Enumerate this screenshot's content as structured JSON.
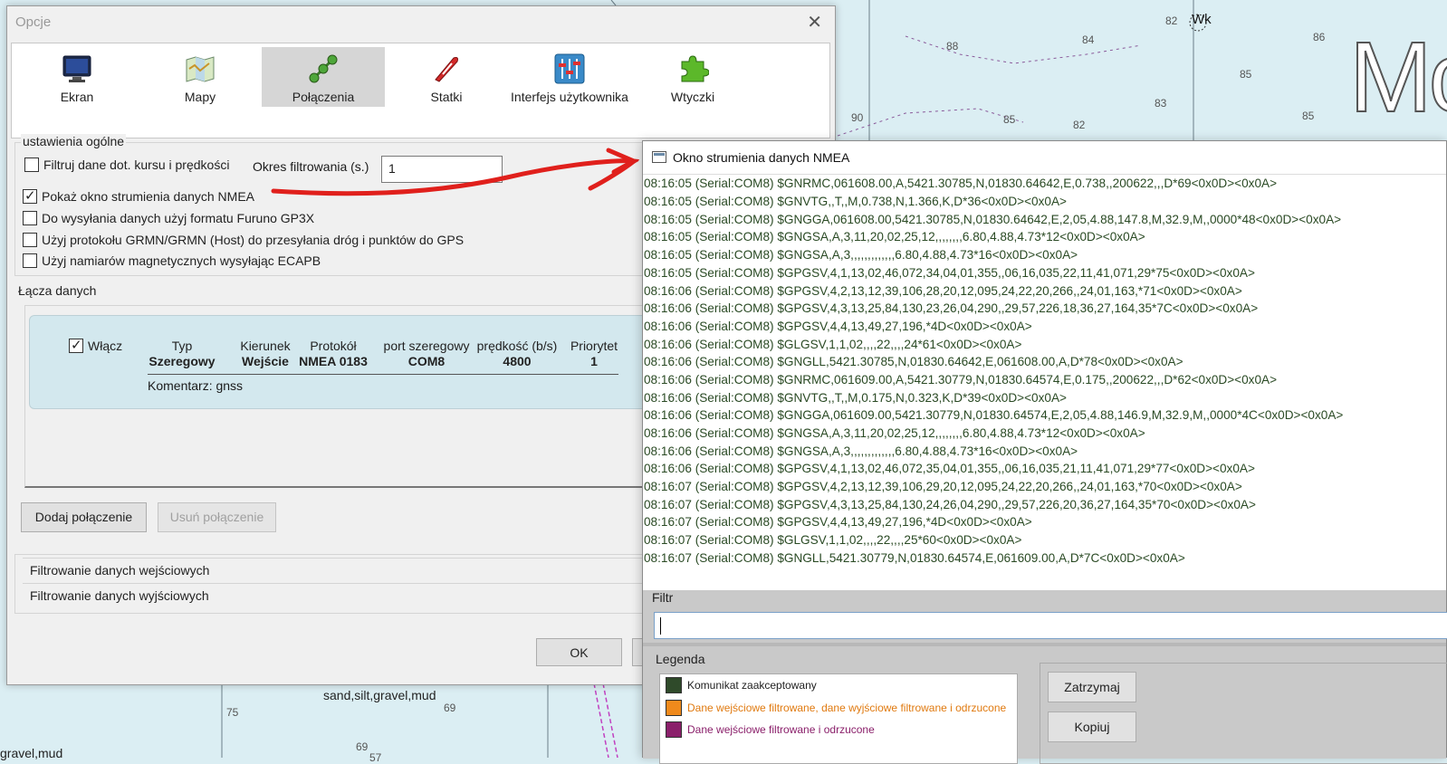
{
  "chart_background": {
    "depths": [
      "82",
      "88",
      "84",
      "86",
      "85",
      "83",
      "90",
      "85",
      "82",
      "85",
      "75",
      "69",
      "69",
      "57"
    ],
    "big_text": "Mo",
    "wreck_label": "Wk",
    "seabed_note": "sand,silt,gravel,mud",
    "seabed_note_2": "gravel,mud"
  },
  "options_dialog": {
    "title": "Opcje",
    "close": "✕",
    "tabs": [
      {
        "label": "Ekran",
        "icon": "monitor-icon"
      },
      {
        "label": "Mapy",
        "icon": "map-icon"
      },
      {
        "label": "Połączenia",
        "icon": "connections-icon"
      },
      {
        "label": "Statki",
        "icon": "boat-icon"
      },
      {
        "label": "Interfejs użytkownika",
        "icon": "sliders-icon"
      },
      {
        "label": "Wtyczki",
        "icon": "puzzle-icon"
      }
    ],
    "active_tab": "Połączenia",
    "general": {
      "group_label": "ustawienia ogólne",
      "filter_course_speed": {
        "label": "Filtruj dane dot. kursu i prędkości",
        "checked": false
      },
      "filter_period_label": "Okres filtrowania (s.)",
      "filter_period_value": "1",
      "show_nmea": {
        "label": "Pokaż okno strumienia danych NMEA",
        "checked": true
      },
      "furuno": {
        "label": "Do wysyłania danych użyj formatu Furuno GP3X",
        "checked": false
      },
      "grmn": {
        "label": "Użyj protokołu GRMN/GRMN (Host) do przesyłania dróg i punktów do GPS",
        "checked": false
      },
      "ecapb": {
        "label": "Użyj namiarów magnetycznych wysyłając ECAPB",
        "checked": false
      }
    },
    "data_links": {
      "group_label": "Łącza danych",
      "enable_label": "Włącz",
      "enabled": true,
      "headers": {
        "type": "Typ",
        "direction": "Kierunek",
        "protocol": "Protokół",
        "port": "port szeregowy",
        "speed": "prędkość (b/s)",
        "priority": "Priorytet"
      },
      "row": {
        "type": "Szeregowy",
        "direction": "Wejście",
        "protocol": "NMEA 0183",
        "port": "COM8",
        "speed": "4800",
        "priority": "1"
      },
      "comment": "Komentarz: gnss"
    },
    "buttons": {
      "add": "Dodaj połączenie",
      "remove": "Usuń połączenie",
      "ok": "OK"
    },
    "input_filtering": "Filtrowanie danych wejściowych",
    "output_filtering": "Filtrowanie danych wyjściowych"
  },
  "nmea_window": {
    "title": "Okno strumienia danych NMEA",
    "lines": [
      "08:16:05 (Serial:COM8) $GNRMC,061608.00,A,5421.30785,N,01830.64642,E,0.738,,200622,,,D*69<0x0D><0x0A>",
      "08:16:05 (Serial:COM8) $GNVTG,,T,,M,0.738,N,1.366,K,D*36<0x0D><0x0A>",
      "08:16:05 (Serial:COM8) $GNGGA,061608.00,5421.30785,N,01830.64642,E,2,05,4.88,147.8,M,32.9,M,,0000*48<0x0D><0x0A>",
      "08:16:05 (Serial:COM8) $GNGSA,A,3,11,20,02,25,12,,,,,,,,6.80,4.88,4.73*12<0x0D><0x0A>",
      "08:16:05 (Serial:COM8) $GNGSA,A,3,,,,,,,,,,,,,6.80,4.88,4.73*16<0x0D><0x0A>",
      "08:16:05 (Serial:COM8) $GPGSV,4,1,13,02,46,072,34,04,01,355,,06,16,035,22,11,41,071,29*75<0x0D><0x0A>",
      "08:16:06 (Serial:COM8) $GPGSV,4,2,13,12,39,106,28,20,12,095,24,22,20,266,,24,01,163,*71<0x0D><0x0A>",
      "08:16:06 (Serial:COM8) $GPGSV,4,3,13,25,84,130,23,26,04,290,,29,57,226,18,36,27,164,35*7C<0x0D><0x0A>",
      "08:16:06 (Serial:COM8) $GPGSV,4,4,13,49,27,196,*4D<0x0D><0x0A>",
      "08:16:06 (Serial:COM8) $GLGSV,1,1,02,,,,22,,,,24*61<0x0D><0x0A>",
      "08:16:06 (Serial:COM8) $GNGLL,5421.30785,N,01830.64642,E,061608.00,A,D*78<0x0D><0x0A>",
      "08:16:06 (Serial:COM8) $GNRMC,061609.00,A,5421.30779,N,01830.64574,E,0.175,,200622,,,D*62<0x0D><0x0A>",
      "08:16:06 (Serial:COM8) $GNVTG,,T,,M,0.175,N,0.323,K,D*39<0x0D><0x0A>",
      "08:16:06 (Serial:COM8) $GNGGA,061609.00,5421.30779,N,01830.64574,E,2,05,4.88,146.9,M,32.9,M,,0000*4C<0x0D><0x0A>",
      "08:16:06 (Serial:COM8) $GNGSA,A,3,11,20,02,25,12,,,,,,,,6.80,4.88,4.73*12<0x0D><0x0A>",
      "08:16:06 (Serial:COM8) $GNGSA,A,3,,,,,,,,,,,,,6.80,4.88,4.73*16<0x0D><0x0A>",
      "08:16:06 (Serial:COM8) $GPGSV,4,1,13,02,46,072,35,04,01,355,,06,16,035,21,11,41,071,29*77<0x0D><0x0A>",
      "08:16:07 (Serial:COM8) $GPGSV,4,2,13,12,39,106,29,20,12,095,24,22,20,266,,24,01,163,*70<0x0D><0x0A>",
      "08:16:07 (Serial:COM8) $GPGSV,4,3,13,25,84,130,24,26,04,290,,29,57,226,20,36,27,164,35*70<0x0D><0x0A>",
      "08:16:07 (Serial:COM8) $GPGSV,4,4,13,49,27,196,*4D<0x0D><0x0A>",
      "08:16:07 (Serial:COM8) $GLGSV,1,1,02,,,,22,,,,25*60<0x0D><0x0A>",
      "08:16:07 (Serial:COM8) $GNGLL,5421.30779,N,01830.64574,E,061609.00,A,D*7C<0x0D><0x0A>"
    ],
    "filter_label": "Filtr",
    "filter_value": "",
    "legend_label": "Legenda",
    "legend_items": [
      {
        "label": "Komunikat zaakceptowany",
        "color": "#2f4a2a",
        "text_color": "#222222"
      },
      {
        "label": "Dane wejściowe filtrowane, dane wyjściowe filtrowane i odrzucone",
        "color": "#f08a1c",
        "text_color": "#e07a10"
      },
      {
        "label": "Dane wejściowe filtrowane i odrzucone",
        "color": "#8a1f6a",
        "text_color": "#8a1f6a"
      }
    ],
    "buttons": {
      "stop": "Zatrzymaj",
      "copy": "Kopiuj"
    }
  }
}
